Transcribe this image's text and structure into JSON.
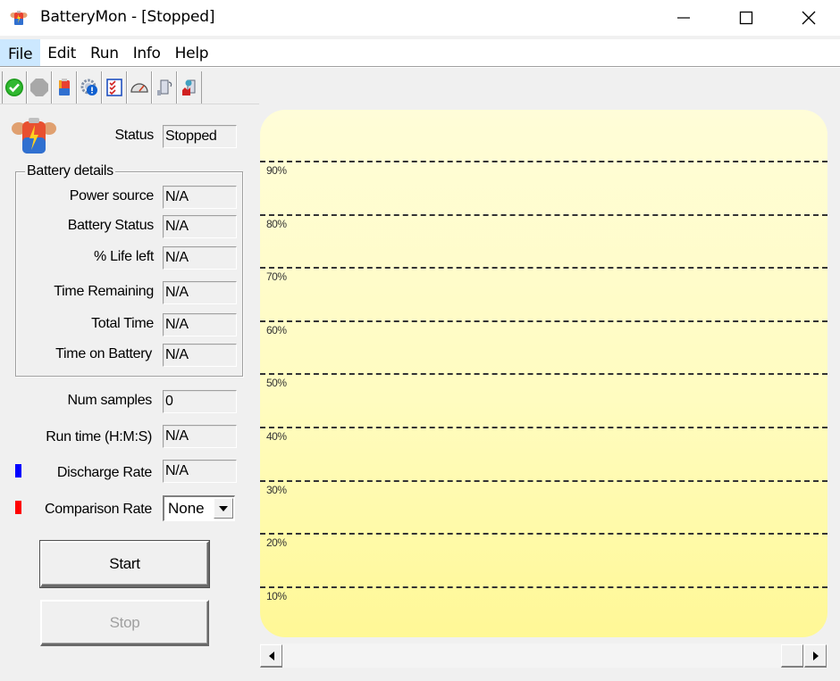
{
  "window": {
    "title": "BatteryMon - [Stopped]",
    "icon": "battery-app-icon",
    "controls": [
      "minimize",
      "maximize",
      "close"
    ]
  },
  "menu": {
    "items": [
      {
        "label": "File",
        "active": true
      },
      {
        "label": "Edit"
      },
      {
        "label": "Run"
      },
      {
        "label": "Info"
      },
      {
        "label": "Help"
      }
    ]
  },
  "toolbar": {
    "buttons": [
      {
        "icon": "start-check-icon",
        "tooltip": "Start"
      },
      {
        "icon": "stop-octagon-icon",
        "tooltip": "Stop"
      },
      {
        "icon": "battery-icon",
        "tooltip": "Battery info"
      },
      {
        "icon": "gear-info-icon",
        "tooltip": "Settings"
      },
      {
        "icon": "checklist-icon",
        "tooltip": "Options"
      },
      {
        "icon": "gauge-icon",
        "tooltip": "Gauge"
      },
      {
        "icon": "device-icon",
        "tooltip": "Device"
      },
      {
        "icon": "device-alert-icon",
        "tooltip": "Alert"
      }
    ]
  },
  "status": {
    "label": "Status",
    "value": "Stopped"
  },
  "battery_details": {
    "title": "Battery details",
    "rows": [
      {
        "label": "Power source",
        "value": "N/A"
      },
      {
        "label": "Battery Status",
        "value": "N/A"
      },
      {
        "label": "% Life left",
        "value": "N/A"
      },
      {
        "label": "Time Remaining",
        "value": "N/A"
      },
      {
        "label": "Total Time",
        "value": "N/A"
      },
      {
        "label": "Time on Battery",
        "value": "N/A"
      }
    ]
  },
  "stats": {
    "num_samples": {
      "label": "Num samples",
      "value": "0"
    },
    "run_time": {
      "label": "Run time (H:M:S)",
      "value": "N/A"
    },
    "discharge_rate": {
      "label": "Discharge Rate",
      "value": "N/A",
      "color": "#0000ff"
    },
    "comparison_rate": {
      "label": "Comparison Rate",
      "selected": "None",
      "color": "#ff0000"
    }
  },
  "buttons": {
    "start": "Start",
    "stop": "Stop"
  },
  "chart_data": {
    "type": "line",
    "title": "",
    "xlabel": "",
    "ylabel": "",
    "ylim": [
      0,
      100
    ],
    "grid": true,
    "y_ticks": [
      "90%",
      "80%",
      "70%",
      "60%",
      "50%",
      "40%",
      "30%",
      "20%",
      "10%"
    ],
    "y_tick_values": [
      90,
      80,
      70,
      60,
      50,
      40,
      30,
      20,
      10
    ],
    "series": [
      {
        "name": "Discharge Rate",
        "color": "#0000ff",
        "values": []
      },
      {
        "name": "Comparison Rate",
        "color": "#ff0000",
        "values": []
      }
    ]
  }
}
